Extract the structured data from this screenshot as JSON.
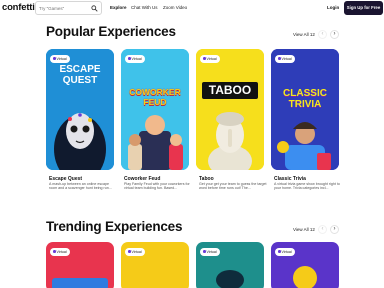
{
  "nav": {
    "logo": "confetti",
    "search_placeholder": "Try \"Games\"",
    "links": [
      "Explore",
      "Chat With Us",
      "Zoom Video"
    ],
    "login": "Login",
    "signup": "Sign Up for Free"
  },
  "popular": {
    "title": "Popular Experiences",
    "view_all": "View All 12",
    "cards": [
      {
        "badge": "Virtual",
        "art": "ESCAPE QUEST",
        "title": "Escape Quest",
        "desc": "A mash-up between an online escape room and a scavenger hunt being run...",
        "color": "#1f8fd6"
      },
      {
        "badge": "Virtual",
        "art": "COWORKER FEUD",
        "title": "Coworker Feud",
        "desc": "Play Family Feud with your coworkers for virtual team building fun. Based...",
        "color": "#3fc2ea"
      },
      {
        "badge": "Virtual",
        "art": "TABOO",
        "title": "Taboo",
        "desc": "Get your get your team to guess the target word before time runs out! The...",
        "color": "#f6df1c"
      },
      {
        "badge": "Virtual",
        "art": "CLASSIC TRIVIA",
        "title": "Classic Trivia",
        "desc": "A virtual trivia game show brought right to your home. Trivia categories incl...",
        "color": "#2e3db8"
      }
    ]
  },
  "trending": {
    "title": "Trending Experiences",
    "view_all": "View All 12",
    "cards": [
      {
        "badge": "Virtual",
        "color": "#e8344e"
      },
      {
        "badge": "Virtual",
        "color": "#f5cb18"
      },
      {
        "badge": "Virtual",
        "color": "#1e8f8c"
      },
      {
        "badge": "Virtual",
        "color": "#5a34c9"
      }
    ]
  }
}
